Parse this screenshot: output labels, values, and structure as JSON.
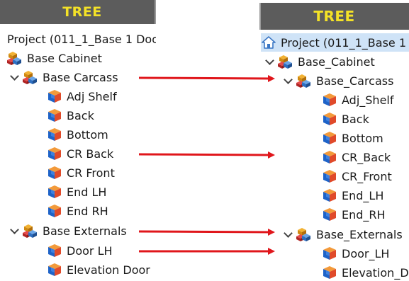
{
  "colors": {
    "header_bg": "#5c5c5c",
    "header_text": "#f4e227",
    "arrow": "#e0161b",
    "selected_bg": "#cfe3f7"
  },
  "left": {
    "title": "TREE",
    "rows": [
      {
        "label": "Project (011_1_Base 1 Doo",
        "icon": "none",
        "chevron": false
      },
      {
        "label": "Base Cabinet",
        "icon": "assembly-icon",
        "chevron": false
      },
      {
        "label": "Base Carcass",
        "icon": "assembly-icon",
        "chevron": true
      },
      {
        "label": "Adj Shelf",
        "icon": "part-icon",
        "chevron": false
      },
      {
        "label": "Back",
        "icon": "part-icon",
        "chevron": false
      },
      {
        "label": "Bottom",
        "icon": "part-icon",
        "chevron": false
      },
      {
        "label": "CR Back",
        "icon": "part-icon",
        "chevron": false
      },
      {
        "label": "CR Front",
        "icon": "part-icon",
        "chevron": false
      },
      {
        "label": "End LH",
        "icon": "part-icon",
        "chevron": false
      },
      {
        "label": "End RH",
        "icon": "part-icon",
        "chevron": false
      },
      {
        "label": "Base Externals",
        "icon": "assembly-icon",
        "chevron": true
      },
      {
        "label": "Door LH",
        "icon": "part-icon",
        "chevron": false
      },
      {
        "label": "Elevation  Door",
        "icon": "part-icon",
        "chevron": false
      }
    ]
  },
  "right": {
    "title": "TREE",
    "rows": [
      {
        "label": "Project (011_1_Base 1",
        "icon": "home-icon",
        "chevron": false,
        "selected": true
      },
      {
        "label": "Base_Cabinet",
        "icon": "assembly-icon",
        "chevron": true
      },
      {
        "label": "Base_Carcass",
        "icon": "assembly-icon",
        "chevron": true
      },
      {
        "label": "Adj_Shelf",
        "icon": "part-icon",
        "chevron": false
      },
      {
        "label": "Back",
        "icon": "part-icon",
        "chevron": false
      },
      {
        "label": "Bottom",
        "icon": "part-icon",
        "chevron": false
      },
      {
        "label": "CR_Back",
        "icon": "part-icon",
        "chevron": false
      },
      {
        "label": "CR_Front",
        "icon": "part-icon",
        "chevron": false
      },
      {
        "label": "End_LH",
        "icon": "part-icon",
        "chevron": false
      },
      {
        "label": "End_RH",
        "icon": "part-icon",
        "chevron": false
      },
      {
        "label": "Base_Externals",
        "icon": "assembly-icon",
        "chevron": true
      },
      {
        "label": "Door_LH",
        "icon": "part-icon",
        "chevron": false
      },
      {
        "label": "Elevation_D",
        "icon": "part-icon",
        "chevron": false
      }
    ]
  },
  "arrows": [
    {
      "from": "Base Carcass",
      "to": "Base_Carcass"
    },
    {
      "from": "CR Back",
      "to": "CR_Back"
    },
    {
      "from": "Base Externals",
      "to": "Base_Externals"
    },
    {
      "from": "Door LH",
      "to": "Door_LH"
    }
  ]
}
